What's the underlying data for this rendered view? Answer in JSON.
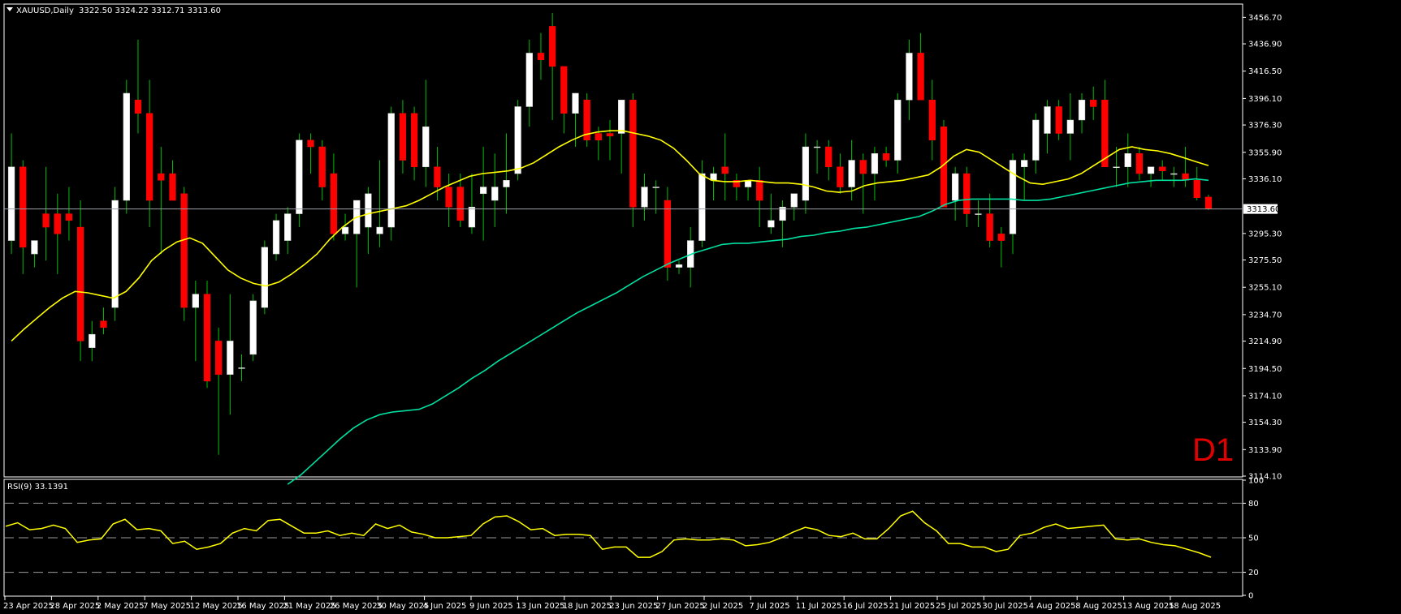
{
  "main": {
    "symbol": "XAUUSD,Daily",
    "ohlc": "3322.50 3324.22 3312.71 3313.60",
    "timeframe": "D1",
    "current_price_label": "3313.60",
    "price_ticks": [
      "3456.70",
      "3436.90",
      "3416.50",
      "3396.10",
      "3376.30",
      "3355.90",
      "3336.10",
      "3313.60",
      "3295.30",
      "3275.50",
      "3255.10",
      "3234.70",
      "3214.90",
      "3194.50",
      "3174.10",
      "3154.30",
      "3133.90",
      "3114.10"
    ],
    "date_labels": [
      "23 Apr 2025",
      "28 Apr 2025",
      "2 May 2025",
      "7 May 2025",
      "12 May 2025",
      "16 May 2025",
      "21 May 2025",
      "26 May 2025",
      "30 May 2025",
      "4 Jun 2025",
      "9 Jun 2025",
      "13 Jun 2025",
      "18 Jun 2025",
      "23 Jun 2025",
      "27 Jun 2025",
      "2 Jul 2025",
      "7 Jul 2025",
      "11 Jul 2025",
      "16 Jul 2025",
      "21 Jul 2025",
      "25 Jul 2025",
      "30 Jul 2025",
      "4 Aug 2025",
      "8 Aug 2025",
      "13 Aug 2025",
      "18 Aug 2025"
    ]
  },
  "rsi": {
    "label": "RSI(9) 33.1391",
    "ticks": [
      "100",
      "80",
      "50",
      "20",
      "0"
    ],
    "levels": [
      80,
      50,
      20
    ]
  },
  "colors": {
    "background": "#000000",
    "bull": "#ffffff",
    "bear": "#ff0000",
    "wick_up": "#00c000",
    "wick_down": "#00c000",
    "ma_fast": "#ffff00",
    "ma_slow": "#00e0a0",
    "rsi_line": "#ffff00",
    "timeframe": "#e00000"
  },
  "chart_data": {
    "type": "candlestick",
    "title": "XAUUSD,Daily",
    "ylim": [
      3114.1,
      3466.0
    ],
    "candles": [
      [
        3290,
        3370,
        3280,
        3345
      ],
      [
        3345,
        3350,
        3265,
        3285
      ],
      [
        3280,
        3290,
        3270,
        3290
      ],
      [
        3310,
        3345,
        3275,
        3300
      ],
      [
        3310,
        3325,
        3265,
        3295
      ],
      [
        3310,
        3330,
        3290,
        3305
      ],
      [
        3300,
        3320,
        3200,
        3215
      ],
      [
        3210,
        3230,
        3200,
        3220
      ],
      [
        3230,
        3240,
        3220,
        3225
      ],
      [
        3240,
        3330,
        3230,
        3320
      ],
      [
        3320,
        3410,
        3310,
        3400
      ],
      [
        3395,
        3440,
        3370,
        3385
      ],
      [
        3385,
        3410,
        3300,
        3320
      ],
      [
        3340,
        3360,
        3280,
        3335
      ],
      [
        3340,
        3350,
        3320,
        3320
      ],
      [
        3325,
        3330,
        3230,
        3240
      ],
      [
        3240,
        3260,
        3200,
        3250
      ],
      [
        3250,
        3260,
        3180,
        3185
      ],
      [
        3215,
        3225,
        3130,
        3190
      ],
      [
        3190,
        3250,
        3160,
        3215
      ],
      [
        3195,
        3205,
        3185,
        3195
      ],
      [
        3205,
        3250,
        3200,
        3245
      ],
      [
        3240,
        3290,
        3235,
        3285
      ],
      [
        3280,
        3310,
        3275,
        3305
      ],
      [
        3290,
        3315,
        3280,
        3310
      ],
      [
        3310,
        3370,
        3300,
        3365
      ],
      [
        3365,
        3370,
        3340,
        3360
      ],
      [
        3360,
        3365,
        3320,
        3330
      ],
      [
        3340,
        3355,
        3290,
        3295
      ],
      [
        3295,
        3310,
        3290,
        3300
      ],
      [
        3295,
        3320,
        3255,
        3320
      ],
      [
        3300,
        3330,
        3280,
        3325
      ],
      [
        3295,
        3350,
        3285,
        3300
      ],
      [
        3300,
        3390,
        3290,
        3385
      ],
      [
        3385,
        3395,
        3340,
        3350
      ],
      [
        3385,
        3390,
        3335,
        3345
      ],
      [
        3345,
        3410,
        3330,
        3375
      ],
      [
        3345,
        3360,
        3320,
        3330
      ],
      [
        3330,
        3340,
        3300,
        3315
      ],
      [
        3330,
        3340,
        3300,
        3305
      ],
      [
        3300,
        3340,
        3295,
        3315
      ],
      [
        3325,
        3360,
        3290,
        3330
      ],
      [
        3320,
        3355,
        3300,
        3330
      ],
      [
        3330,
        3370,
        3310,
        3335
      ],
      [
        3340,
        3395,
        3335,
        3390
      ],
      [
        3390,
        3440,
        3375,
        3430
      ],
      [
        3430,
        3445,
        3410,
        3425
      ],
      [
        3450,
        3460,
        3380,
        3420
      ],
      [
        3420,
        3420,
        3370,
        3385
      ],
      [
        3385,
        3395,
        3360,
        3400
      ],
      [
        3395,
        3400,
        3360,
        3365
      ],
      [
        3370,
        3375,
        3350,
        3365
      ],
      [
        3370,
        3380,
        3350,
        3368
      ],
      [
        3370,
        3395,
        3340,
        3395
      ],
      [
        3395,
        3400,
        3300,
        3315
      ],
      [
        3315,
        3340,
        3305,
        3330
      ],
      [
        3330,
        3335,
        3310,
        3330
      ],
      [
        3320,
        3330,
        3260,
        3270
      ],
      [
        3270,
        3275,
        3265,
        3272
      ],
      [
        3270,
        3300,
        3255,
        3290
      ],
      [
        3290,
        3350,
        3285,
        3340
      ],
      [
        3335,
        3345,
        3320,
        3340
      ],
      [
        3345,
        3370,
        3320,
        3340
      ],
      [
        3335,
        3340,
        3320,
        3330
      ],
      [
        3330,
        3335,
        3320,
        3335
      ],
      [
        3335,
        3345,
        3300,
        3320
      ],
      [
        3300,
        3325,
        3295,
        3305
      ],
      [
        3305,
        3320,
        3285,
        3315
      ],
      [
        3315,
        3325,
        3305,
        3325
      ],
      [
        3320,
        3370,
        3310,
        3360
      ],
      [
        3360,
        3365,
        3340,
        3360
      ],
      [
        3360,
        3365,
        3335,
        3345
      ],
      [
        3345,
        3355,
        3325,
        3330
      ],
      [
        3330,
        3365,
        3320,
        3350
      ],
      [
        3350,
        3355,
        3310,
        3340
      ],
      [
        3340,
        3360,
        3320,
        3355
      ],
      [
        3355,
        3360,
        3345,
        3350
      ],
      [
        3350,
        3400,
        3340,
        3395
      ],
      [
        3395,
        3440,
        3380,
        3430
      ],
      [
        3430,
        3445,
        3400,
        3395
      ],
      [
        3395,
        3410,
        3350,
        3365
      ],
      [
        3375,
        3380,
        3325,
        3315
      ],
      [
        3320,
        3345,
        3305,
        3340
      ],
      [
        3340,
        3345,
        3300,
        3310
      ],
      [
        3310,
        3320,
        3300,
        3310
      ],
      [
        3310,
        3325,
        3285,
        3290
      ],
      [
        3295,
        3300,
        3270,
        3290
      ],
      [
        3295,
        3355,
        3280,
        3350
      ],
      [
        3345,
        3355,
        3320,
        3350
      ],
      [
        3350,
        3385,
        3340,
        3380
      ],
      [
        3370,
        3395,
        3355,
        3390
      ],
      [
        3390,
        3395,
        3365,
        3370
      ],
      [
        3370,
        3400,
        3350,
        3380
      ],
      [
        3380,
        3400,
        3370,
        3395
      ],
      [
        3395,
        3405,
        3380,
        3390
      ],
      [
        3395,
        3410,
        3345,
        3345
      ],
      [
        3345,
        3360,
        3330,
        3345
      ],
      [
        3345,
        3370,
        3330,
        3355
      ],
      [
        3355,
        3360,
        3335,
        3340
      ],
      [
        3340,
        3345,
        3330,
        3345
      ],
      [
        3345,
        3350,
        3335,
        3342
      ],
      [
        3340,
        3345,
        3330,
        3340
      ],
      [
        3340,
        3360,
        3330,
        3335
      ],
      [
        3335,
        3345,
        3320,
        3322
      ],
      [
        3322.5,
        3324.22,
        3312.71,
        3313.6
      ]
    ],
    "ma_fast": [
      3215,
      3224,
      3232,
      3240,
      3247,
      3252,
      3251,
      3249,
      3247,
      3252,
      3262,
      3275,
      3283,
      3289,
      3292,
      3288,
      3278,
      3268,
      3262,
      3258,
      3256,
      3259,
      3265,
      3272,
      3280,
      3291,
      3300,
      3307,
      3310,
      3312,
      3314,
      3316,
      3320,
      3325,
      3330,
      3334,
      3338,
      3340,
      3341,
      3342,
      3344,
      3348,
      3354,
      3360,
      3365,
      3369,
      3371,
      3372,
      3372,
      3370,
      3368,
      3365,
      3359,
      3350,
      3340,
      3335,
      3334,
      3334,
      3335,
      3334,
      3333,
      3333,
      3332,
      3330,
      3327,
      3326,
      3327,
      3331,
      3333,
      3334,
      3335,
      3337,
      3339,
      3345,
      3353,
      3358,
      3356,
      3350,
      3344,
      3338,
      3333,
      3332,
      3334,
      3336,
      3340,
      3346,
      3352,
      3358,
      3360,
      3358,
      3357,
      3355,
      3352,
      3349,
      3346
    ],
    "ma_slow": [
      3108,
      3115,
      3124,
      3133,
      3142,
      3150,
      3156,
      3160,
      3162,
      3163,
      3164,
      3168,
      3174,
      3180,
      3187,
      3193,
      3200,
      3206,
      3212,
      3218,
      3224,
      3230,
      3236,
      3241,
      3246,
      3251,
      3257,
      3263,
      3268,
      3273,
      3277,
      3281,
      3284,
      3287,
      3288,
      3288,
      3289,
      3290,
      3291,
      3293,
      3294,
      3296,
      3297,
      3299,
      3300,
      3302,
      3304,
      3306,
      3308,
      3312,
      3317,
      3320,
      3321,
      3321,
      3321,
      3321,
      3320,
      3320,
      3321,
      3323,
      3325,
      3327,
      3329,
      3331,
      3333,
      3334,
      3335,
      3335,
      3335,
      3336,
      3335
    ],
    "rsi": [
      60,
      63,
      57,
      58,
      61,
      58,
      46,
      48,
      49,
      62,
      66,
      57,
      58,
      56,
      45,
      47,
      40,
      42,
      45,
      54,
      58,
      56,
      65,
      66,
      60,
      54,
      54,
      56,
      52,
      54,
      52,
      62,
      58,
      61,
      55,
      53,
      50,
      50,
      51,
      52,
      62,
      68,
      69,
      64,
      57,
      58,
      52,
      53,
      53,
      52,
      40,
      42,
      42,
      33,
      33,
      38,
      48,
      49,
      48,
      48,
      49,
      48,
      43,
      44,
      46,
      50,
      55,
      59,
      57,
      52,
      51,
      54,
      49,
      49,
      58,
      69,
      73,
      63,
      56,
      45,
      45,
      42,
      42,
      38,
      40,
      52,
      54,
      59,
      62,
      58,
      59,
      60,
      61,
      49,
      48,
      49,
      46,
      44,
      43,
      40,
      37,
      33.1
    ],
    "rsi_ylim": [
      0,
      100
    ]
  }
}
